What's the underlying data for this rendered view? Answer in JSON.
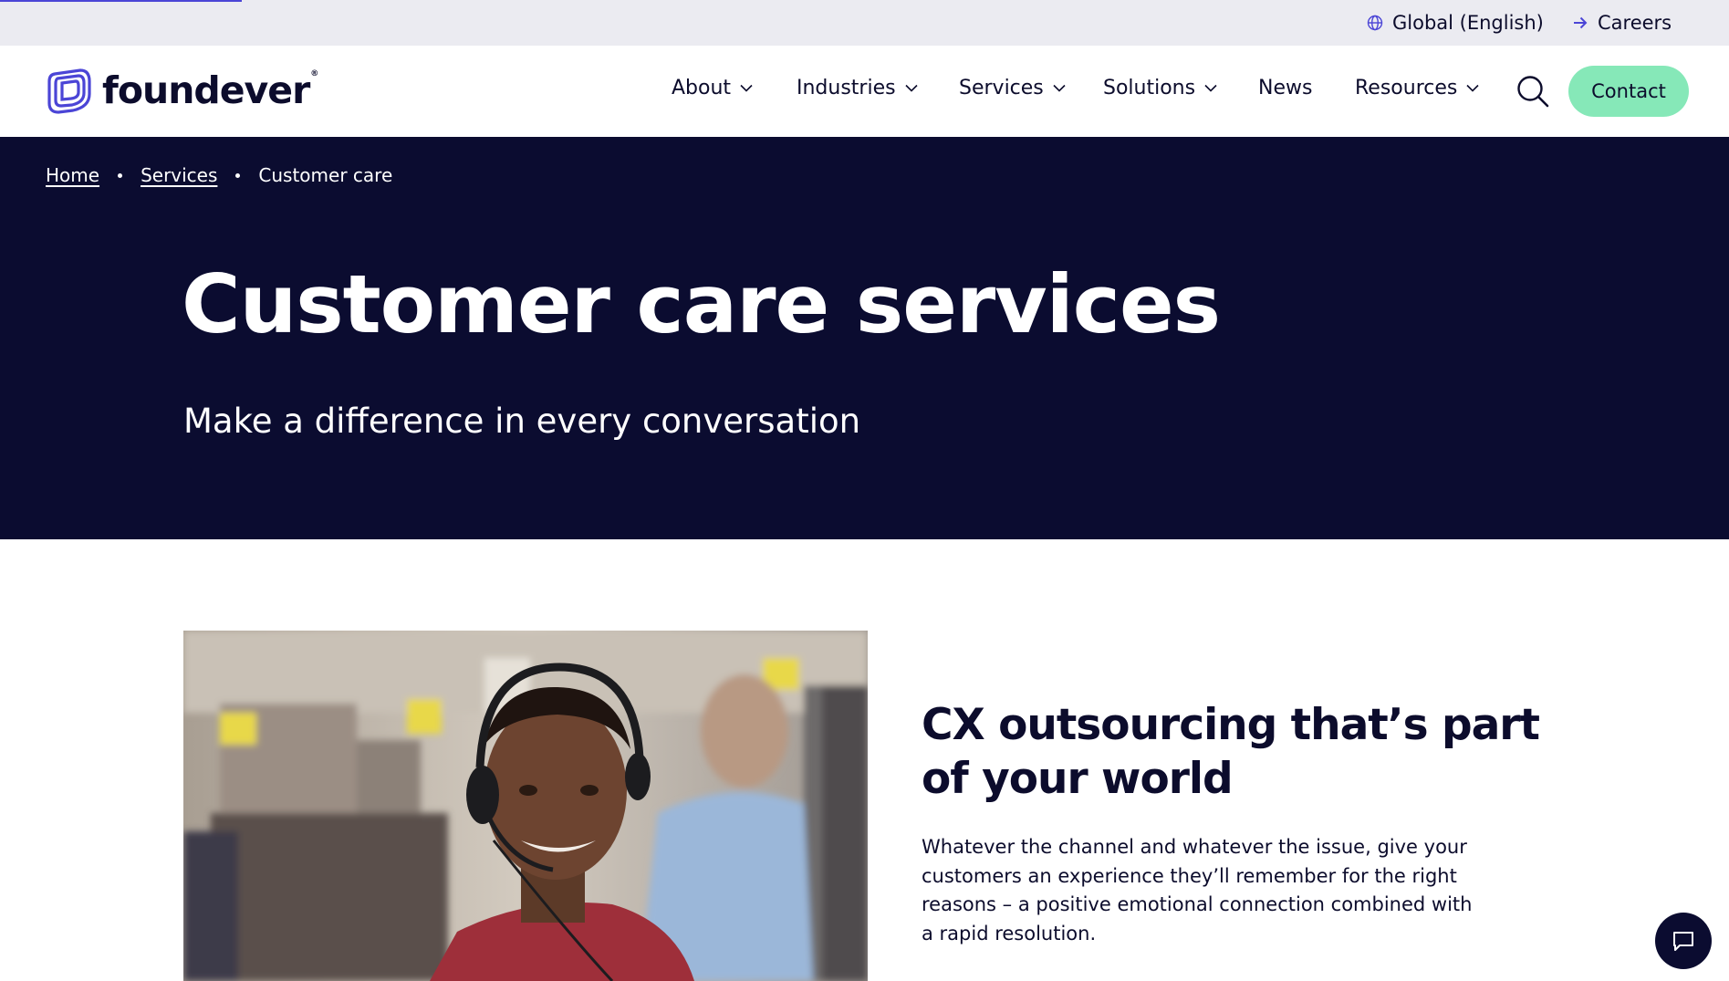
{
  "utility": {
    "language": "Global (English)",
    "careers": "Careers",
    "icons": {
      "language": "globe-icon",
      "careers": "arrow-right-icon"
    }
  },
  "header": {
    "logo_text": "foundever",
    "logo_mark": "®",
    "nav": [
      {
        "label": "About",
        "has_dropdown": true
      },
      {
        "label": "Industries",
        "has_dropdown": true
      },
      {
        "label": "Services",
        "has_dropdown": true
      },
      {
        "label": "Solutions",
        "has_dropdown": true
      },
      {
        "label": "News",
        "has_dropdown": false
      },
      {
        "label": "Resources",
        "has_dropdown": true
      }
    ],
    "contact": "Contact",
    "icons": {
      "search": "search-icon",
      "dropdown": "chevron-down-icon"
    }
  },
  "breadcrumb": {
    "home": "Home",
    "services": "Services",
    "current": "Customer care"
  },
  "hero": {
    "title": "Customer care services",
    "subtitle": "Make a difference in every conversation"
  },
  "section": {
    "title": "CX outsourcing that’s part of your world",
    "body": "Whatever the channel and whatever the issue, give your customers an experience they’ll remember for the right reasons – a positive emotional connection combined with a rapid resolution."
  },
  "chat": {
    "icon": "chat-bubble-icon"
  },
  "colors": {
    "brand_navy": "#0b0c30",
    "accent_mint": "#86e8b8",
    "brand_purple": "#4b45d6",
    "utility_bg": "#ebebf1"
  }
}
